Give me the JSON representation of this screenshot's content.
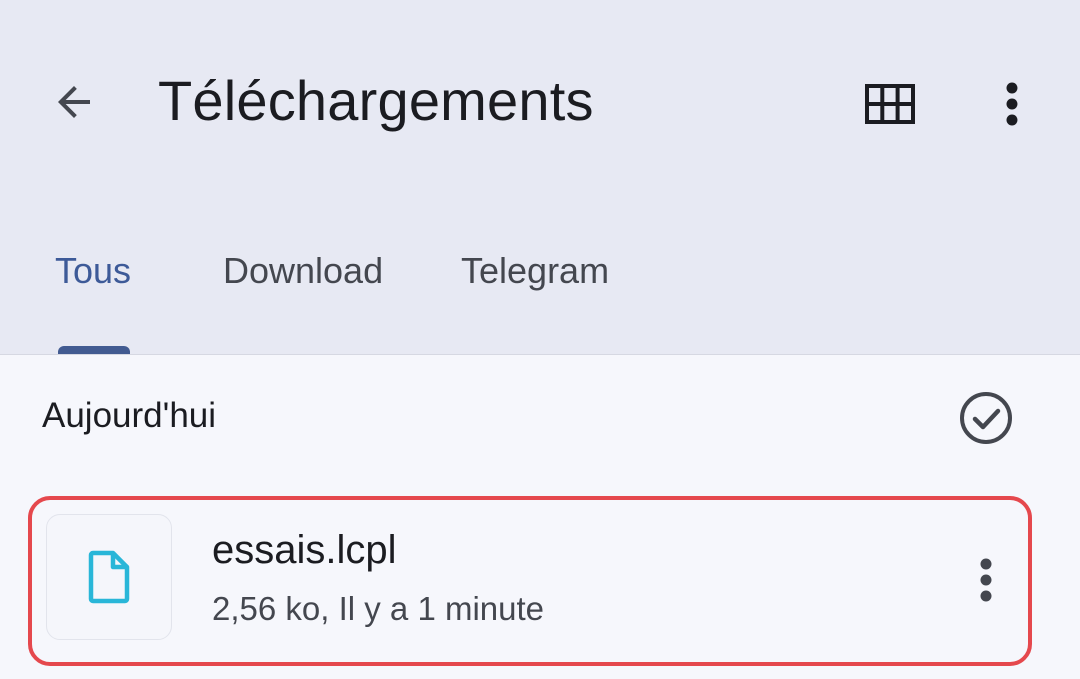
{
  "appbar": {
    "title": "Téléchargements",
    "back_icon": "arrow-back-icon",
    "grid_icon": "grid-view-icon",
    "more_icon": "more-vertical-icon"
  },
  "tabs": [
    {
      "label": "Tous",
      "active": true
    },
    {
      "label": "Download",
      "active": false
    },
    {
      "label": "Telegram",
      "active": false
    }
  ],
  "section": {
    "header": "Aujourd'hui",
    "select_icon": "check-circle-icon"
  },
  "files": [
    {
      "name": "essais.lcpl",
      "meta": "2,56 ko, Il y a 1 minute",
      "icon": "file-icon",
      "highlighted": true
    }
  ],
  "colors": {
    "appbar_bg": "#e7e9f3",
    "body_bg": "#f6f7fc",
    "accent": "#3d5a98",
    "file_icon": "#29b6d8",
    "highlight_border": "#e5484d"
  }
}
